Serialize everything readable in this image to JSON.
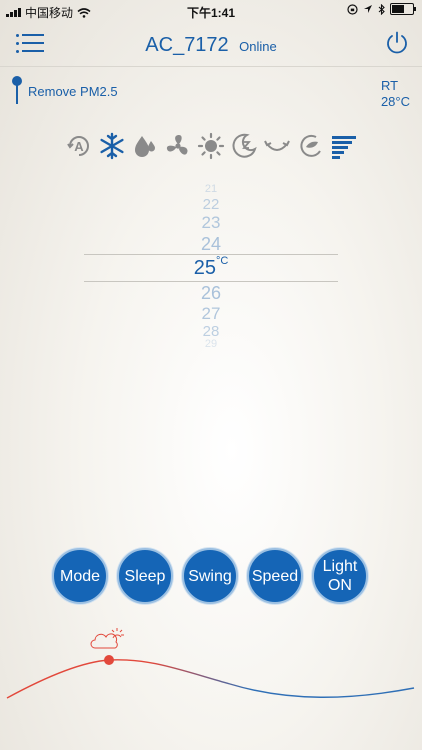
{
  "status_bar": {
    "carrier": "中国移动",
    "time": "下午1:41",
    "battery_level": 0.55
  },
  "header": {
    "device_name": "AC_7172",
    "status": "Online",
    "menu_icon": "menu-list-icon",
    "power_icon": "power-icon"
  },
  "pm": {
    "label": "Remove PM2.5"
  },
  "rt": {
    "label": "RT",
    "value": "28°C"
  },
  "modes": [
    {
      "name": "auto",
      "icon": "auto-mode-icon",
      "label": "A"
    },
    {
      "name": "cool",
      "icon": "snowflake-icon"
    },
    {
      "name": "dry",
      "icon": "drop-icon"
    },
    {
      "name": "fan",
      "icon": "fan-icon"
    },
    {
      "name": "heat",
      "icon": "sun-icon"
    },
    {
      "name": "sleep",
      "icon": "moon-icon"
    },
    {
      "name": "swing",
      "icon": "swing-icon"
    },
    {
      "name": "eco",
      "icon": "leaf-icon"
    },
    {
      "name": "speed",
      "icon": "speed-bars-icon",
      "active": true
    }
  ],
  "temperature": {
    "above": [
      "21",
      "22",
      "23",
      "24"
    ],
    "selected": "25",
    "unit": "°C",
    "below": [
      "26",
      "27",
      "28",
      "29"
    ]
  },
  "buttons": [
    {
      "name": "mode",
      "label": "Mode"
    },
    {
      "name": "sleep",
      "label": "Sleep"
    },
    {
      "name": "swing",
      "label": "Swing"
    },
    {
      "name": "speed",
      "label": "Speed"
    },
    {
      "name": "light",
      "label": "Light\nON"
    }
  ],
  "colors": {
    "accent": "#1565b6",
    "curve_warm": "#e2483b",
    "curve_cool": "#2f6fb6"
  }
}
